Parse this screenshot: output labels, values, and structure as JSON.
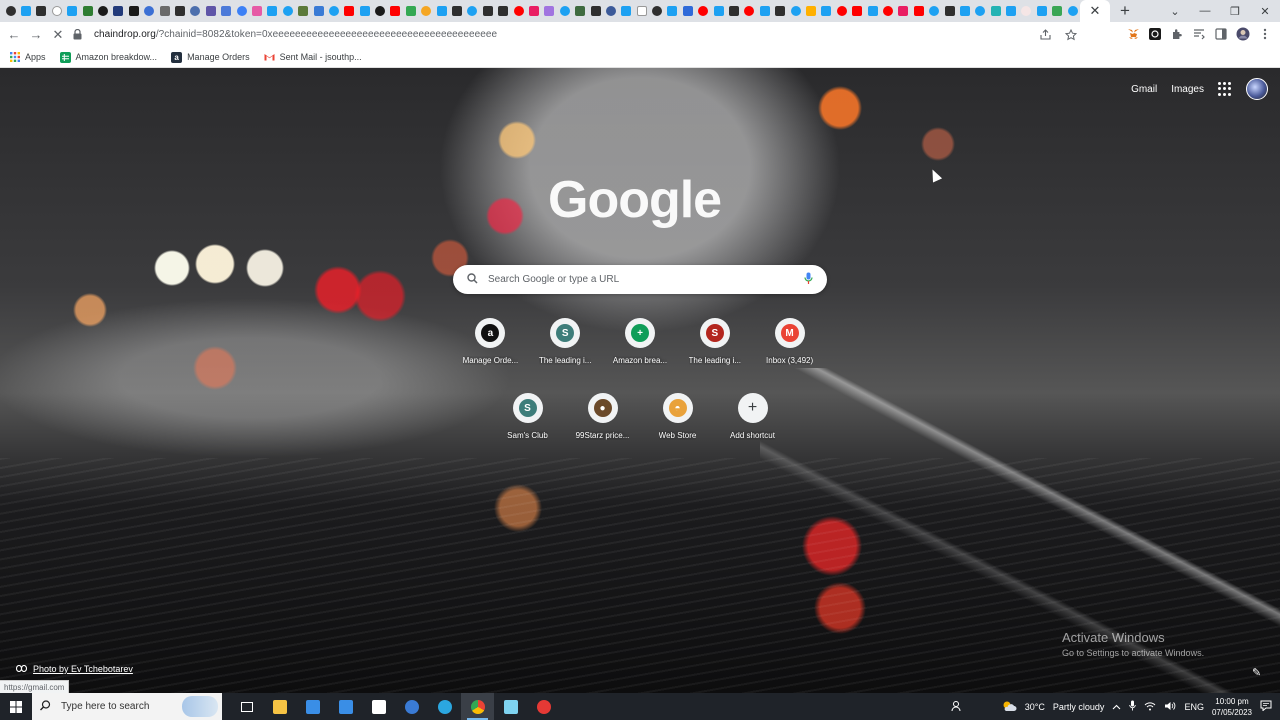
{
  "tabstrip": {
    "active_tab_close": "✕",
    "new_tab": "+",
    "favicon_colors": [
      "#2f2f2f",
      "#1da1f2",
      "#2f2f2f",
      "#ffffff",
      "#1da1f2",
      "#2e7d32",
      "#1a1a1a",
      "#223a7a",
      "#1a1a1a",
      "#3b6fd4",
      "#6a6a6a",
      "#2f2f2f",
      "#4c6fad",
      "#5f55a8",
      "#4c7ad9",
      "#3c80f6",
      "#e65aa6",
      "#1da1f2",
      "#1da1f2",
      "#5c7a3a",
      "#3a7bd5",
      "#1da1f2",
      "#ff0000",
      "#1da1f2",
      "#1a1a1a",
      "#ff0000",
      "#34a853",
      "#f5a623",
      "#1da1f2",
      "#2f2f2f",
      "#1da1f2",
      "#2f2f2f",
      "#2f2f2f",
      "#ff0000",
      "#e91e63",
      "#a174e0",
      "#1da1f2",
      "#3f6b3f",
      "#2f2f2f",
      "#3c5a99",
      "#1da1f2",
      "#ffffff",
      "#2f2f2f",
      "#1da1f2",
      "#2f6ad9",
      "#ff0000",
      "#1da1f2",
      "#2f2f2f",
      "#ff0000",
      "#1da1f2",
      "#2f2f2f",
      "#1da1f2",
      "#ffb000",
      "#1da1f2",
      "#ff0000",
      "#ff0000",
      "#1da1f2",
      "#ff0000",
      "#e91e63",
      "#ff0000",
      "#1da1f2",
      "#2f2f2f",
      "#1da1f2",
      "#1da1f2",
      "#23b3b3",
      "#1da1f2",
      "#f5e6e6",
      "#1da1f2",
      "#3aa655",
      "#1da1f2",
      "#2f2f2f",
      "#1da1f2",
      "#1da1f2",
      "#2f2f2f",
      "#1da1f2",
      "#2f2f2f"
    ]
  },
  "window": {
    "minimize": "—",
    "restore": "❐",
    "close": "✕",
    "tab_search": "⌄"
  },
  "toolbar": {
    "back": "←",
    "forward": "→",
    "reload": "✕",
    "url_host": "chaindrop.org",
    "url_rest": "/?chainid=8082&token=0xeeeeeeeeeeeeeeeeeeeeeeeeeeeeeeeeeeeeeeee"
  },
  "bookmarks": [
    {
      "label": "Apps",
      "icon": "apps-grid-icon",
      "color": "#4285f4"
    },
    {
      "label": "Amazon breakdow...",
      "icon": "google-sheets-icon",
      "color": "#0f9d58"
    },
    {
      "label": "Manage Orders",
      "icon": "amazon-icon",
      "color": "#232f3e"
    },
    {
      "label": "Sent Mail - jsouthp...",
      "icon": "gmail-icon",
      "color": "#ea4335"
    }
  ],
  "ntp": {
    "gmail": "Gmail",
    "images": "Images",
    "logo": "Google",
    "search_placeholder": "Search Google or type a URL",
    "shortcuts_row1": [
      {
        "label": "Manage Orde...",
        "glyph": "a",
        "color": "#111111"
      },
      {
        "label": "The leading i...",
        "glyph": "S",
        "color": "#3d7d7a"
      },
      {
        "label": "Amazon brea...",
        "glyph": "+",
        "color": "#0f9d58"
      },
      {
        "label": "The leading i...",
        "glyph": "S",
        "color": "#b3261e"
      },
      {
        "label": "Inbox (3,492)",
        "glyph": "M",
        "color": "#ea4335"
      }
    ],
    "shortcuts_row2": [
      {
        "label": "Sam's Club",
        "glyph": "S",
        "color": "#3d7d7a"
      },
      {
        "label": "99Starz price...",
        "glyph": "●",
        "color": "#6b4a2a"
      },
      {
        "label": "Web Store",
        "glyph": "◓",
        "color": "#e9a23b"
      },
      {
        "label": "Add shortcut",
        "glyph": "+",
        "color": "#3c4043"
      }
    ],
    "photo_credit": "Photo by Ev Tchebotarev",
    "status_url": "https://gmail.com",
    "activate_title": "Activate Windows",
    "activate_sub": "Go to Settings to activate Windows.",
    "customize": "✎"
  },
  "taskbar": {
    "search_placeholder": "Type here to search",
    "apps": [
      {
        "name": "task-view-icon",
        "color": "#ffffff"
      },
      {
        "name": "file-explorer-icon",
        "color": "#f6c344"
      },
      {
        "name": "microsoft-store-icon",
        "color": "#3a8ee6"
      },
      {
        "name": "mail-icon",
        "color": "#3a8ee6"
      },
      {
        "name": "security-icon",
        "color": "#ffffff"
      },
      {
        "name": "app-blue-icon",
        "color": "#3a7bd5"
      },
      {
        "name": "edge-icon",
        "color": "#2ba7e0"
      },
      {
        "name": "chrome-icon",
        "color": "#fbbc05"
      },
      {
        "name": "notepad-icon",
        "color": "#7fd3f0"
      },
      {
        "name": "screen-recorder-icon",
        "color": "#e53935"
      }
    ],
    "weather": "30°C",
    "weather_desc": "Partly cloudy",
    "language": "ENG",
    "time": "10:00 pm",
    "date": "07/05/2023"
  }
}
